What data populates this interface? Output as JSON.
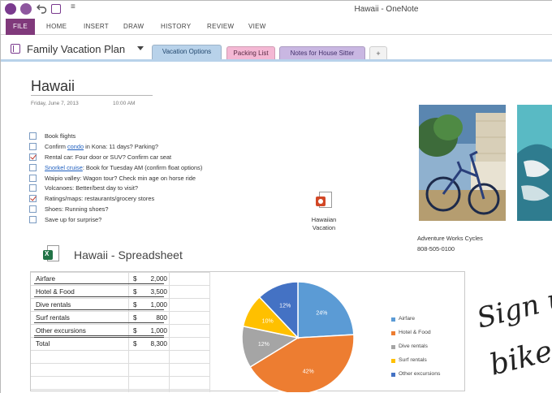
{
  "window": {
    "title": "Hawaii - OneNote"
  },
  "quick_access": {
    "more_glyph": "≡"
  },
  "ribbon": {
    "tabs": [
      "FILE",
      "HOME",
      "INSERT",
      "DRAW",
      "HISTORY",
      "REVIEW",
      "VIEW"
    ]
  },
  "notebook": {
    "name": "Family Vacation Plan",
    "sections": [
      {
        "label": "Vacation Options",
        "color": "#b8d2ea",
        "active": true
      },
      {
        "label": "Packing List",
        "color": "#f4b8d4"
      },
      {
        "label": "Notes for House Sitter",
        "color": "#c9b7e2"
      }
    ],
    "add_section_label": "+"
  },
  "page": {
    "title": "Hawaii",
    "date": "Friday, June 7, 2013",
    "time": "10:00 AM",
    "todos": [
      {
        "pre": "Book flights",
        "checked": false
      },
      {
        "pre": "Confirm ",
        "link": "condo",
        "post": " in Kona: 11 days? Parking?",
        "checked": false
      },
      {
        "pre": "Rental car: Four door or SUV? Confirm car seat",
        "checked": true
      },
      {
        "pre": "",
        "link": "Snorkel cruise",
        "post": ": Book for Tuesday AM (confirm float options)",
        "checked": false
      },
      {
        "pre": "Waipio valley: Wagon tour? Check min age on horse ride",
        "checked": false
      },
      {
        "pre": "Volcanoes: Better/best day to visit?",
        "checked": false
      },
      {
        "pre": "Ratings/maps: restaurants/grocery stores",
        "checked": true
      },
      {
        "pre": "Shoes: Running shoes?",
        "checked": false
      },
      {
        "pre": "Save up for surprise?",
        "checked": false
      }
    ],
    "attachment": {
      "line1": "Hawaiian",
      "line2": "Vacation",
      "icon": "powerpoint-file-icon"
    },
    "photo_caption": {
      "line1": "Adventure Works Cycles",
      "line2": "808-505-0100"
    },
    "handwriting": {
      "line1": "Sign u",
      "line2": "bike"
    }
  },
  "spreadsheet": {
    "title": "Hawaii - Spreadsheet",
    "icon": "excel-file-icon",
    "rows": [
      {
        "label": "Airfare",
        "currency": "$",
        "amount": "2,000"
      },
      {
        "label": "Hotel & Food",
        "currency": "$",
        "amount": "3,500"
      },
      {
        "label": "Dive rentals",
        "currency": "$",
        "amount": "1,000"
      },
      {
        "label": "Surf rentals",
        "currency": "$",
        "amount": "800"
      },
      {
        "label": "Other excursions",
        "currency": "$",
        "amount": "1,000"
      }
    ],
    "total": {
      "label": "Total",
      "currency": "$",
      "amount": "8,300"
    }
  },
  "chart_data": {
    "type": "pie",
    "categories": [
      "Airfare",
      "Hotel & Food",
      "Dive rentals",
      "Surf rentals",
      "Other excursions"
    ],
    "values": [
      2000,
      3500,
      1000,
      800,
      1000
    ],
    "data_labels": [
      "24%",
      "42%",
      "12%",
      "10%",
      "12%"
    ],
    "colors": [
      "#5b9bd5",
      "#ed7d31",
      "#a5a5a5",
      "#ffc000",
      "#4472c4"
    ],
    "legend_position": "right"
  }
}
